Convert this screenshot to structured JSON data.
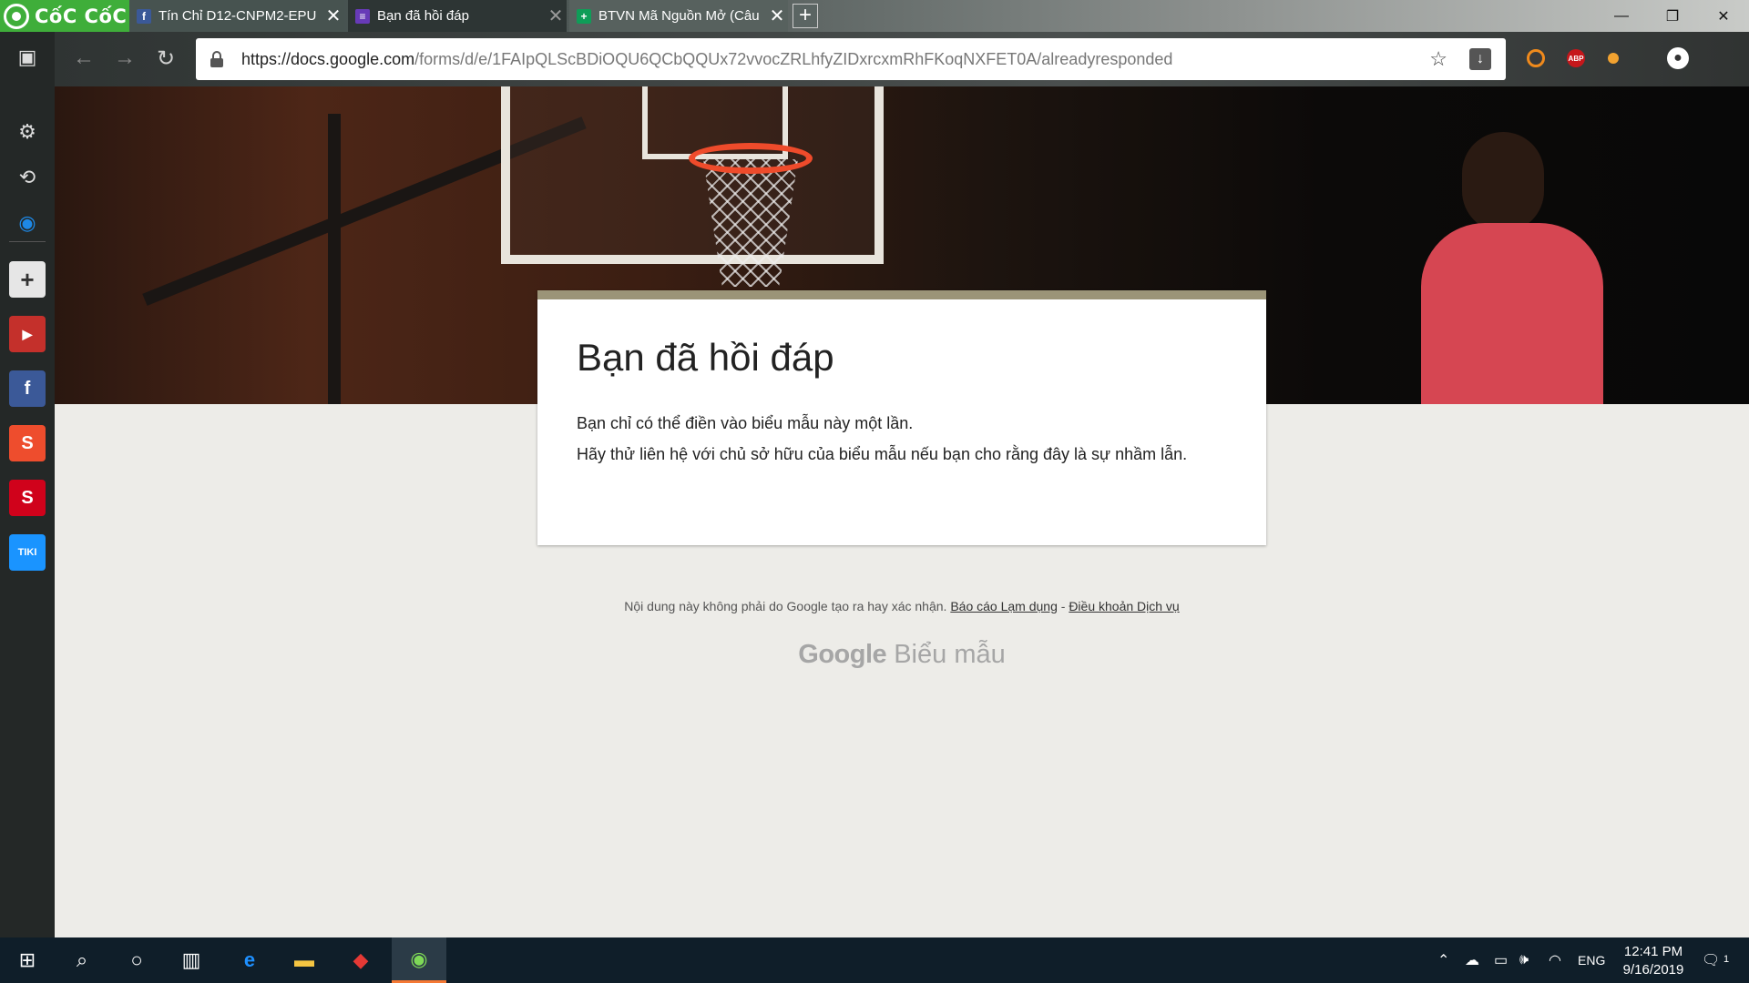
{
  "browser": {
    "brand": "CốC CốC",
    "tabs": [
      {
        "title": "Tín Chỉ D12-CNPM2-EPU",
        "favicon": "f",
        "favicon_color": "#3b5998"
      },
      {
        "title": "Bạn đã hồi đáp",
        "favicon": "≡",
        "favicon_color": "#673ab7"
      },
      {
        "title": "BTVN Mã Nguồn Mở (Câu",
        "favicon": "+",
        "favicon_color": "#0f9d58"
      }
    ],
    "new_tab": "+",
    "url_host": "https://docs.google.com",
    "url_path": "/forms/d/e/1FAIpQLScBDiOQU6QCbQQUx72vvocZRLhfyZIDxrcxmRhFKoqNXFET0A/alreadyresponded",
    "extensions": [
      {
        "icon": "coccoc-extension-icon",
        "label": "",
        "color": "#f08a1c"
      },
      {
        "icon": "adblock-plus-icon",
        "label": "ABP",
        "color": "#c6171b"
      },
      {
        "icon": "coccoc-dictionary-icon",
        "label": "",
        "color": "#f2a230"
      }
    ]
  },
  "sidebar": {
    "apps": [
      {
        "name": "youtube",
        "label": "▶",
        "color": "#c4302b"
      },
      {
        "name": "facebook",
        "label": "f",
        "color": "#3b5998"
      },
      {
        "name": "shopee",
        "label": "S",
        "color": "#ee4d2d"
      },
      {
        "name": "sendo",
        "label": "S",
        "color": "#d0021b"
      },
      {
        "name": "tiki",
        "label": "TIKI",
        "color": "#1a94ff"
      }
    ]
  },
  "form": {
    "title": "Bạn đã hồi đáp",
    "message1": "Bạn chỉ có thể điền vào biểu mẫu này một lần.",
    "message2": "Hãy thử liên hệ với chủ sở hữu của biểu mẫu nếu bạn cho rằng đây là sự nhầm lẫn.",
    "accent_color": "#9b9478"
  },
  "footer": {
    "note": "Nội dung này không phải do Google tạo ra hay xác nhận.",
    "report_link": "Báo cáo Lạm dụng",
    "separator": " - ",
    "terms_link": "Điều khoản Dịch vụ",
    "brand_google": "Google",
    "brand_product": "Biểu mẫu"
  },
  "taskbar": {
    "language": "ENG",
    "time": "12:41 PM",
    "date": "9/16/2019",
    "notifications": "1"
  }
}
